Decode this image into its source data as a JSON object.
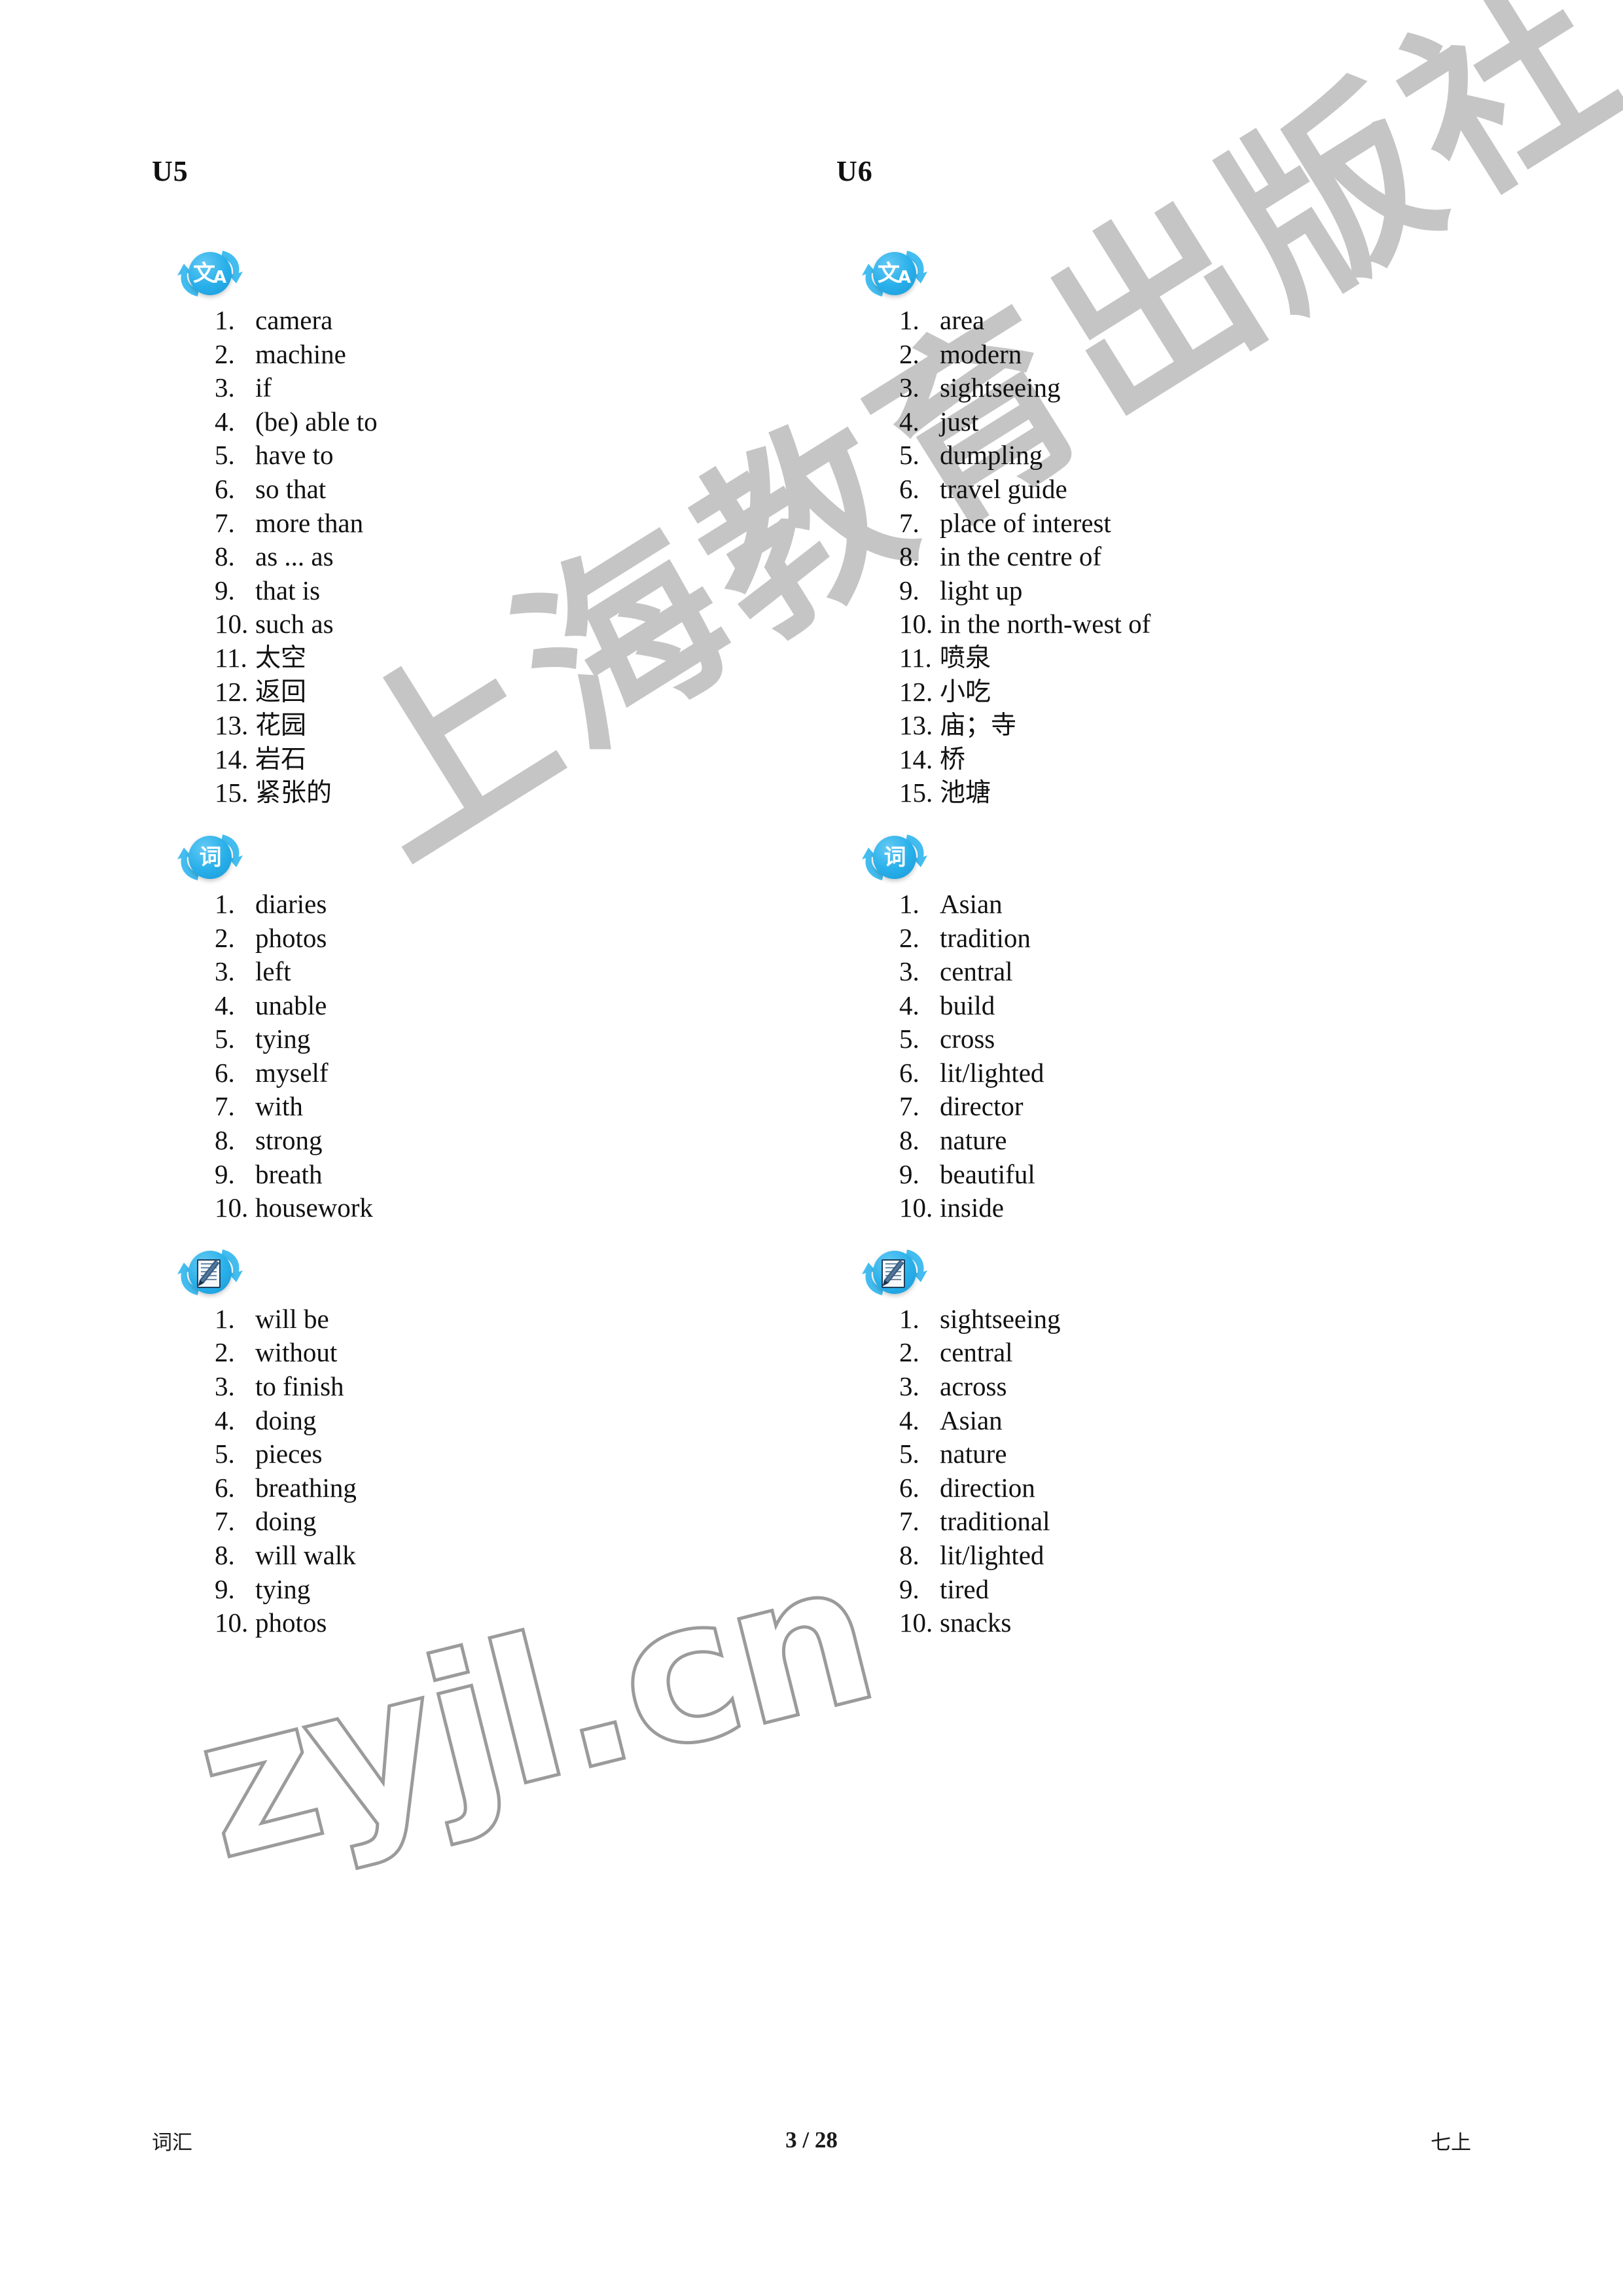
{
  "page": {
    "footer_left": "词汇",
    "footer_center": "3 / 28",
    "footer_right": "七上",
    "watermark_publisher": "上海教育出版社",
    "watermark_site": "zyjl.cn",
    "accent_color": "#29b0ea",
    "watermark_color": "#c2c2c2"
  },
  "columns": [
    {
      "unit": "U5",
      "sections": [
        {
          "icon": "translate-icon",
          "icon_glyph": "文A",
          "items": [
            {
              "n": "1.",
              "t": "camera",
              "cjk": false
            },
            {
              "n": "2.",
              "t": "machine",
              "cjk": false
            },
            {
              "n": "3.",
              "t": "if",
              "cjk": false
            },
            {
              "n": "4.",
              "t": "(be) able to",
              "cjk": false
            },
            {
              "n": "5.",
              "t": "have to",
              "cjk": false
            },
            {
              "n": "6.",
              "t": "so that",
              "cjk": false
            },
            {
              "n": "7.",
              "t": "more than",
              "cjk": false
            },
            {
              "n": "8.",
              "t": "as ... as",
              "cjk": false
            },
            {
              "n": "9.",
              "t": "that is",
              "cjk": false
            },
            {
              "n": "10.",
              "t": "such as",
              "cjk": false
            },
            {
              "n": "11.",
              "t": "太空",
              "cjk": true
            },
            {
              "n": "12.",
              "t": "返回",
              "cjk": true
            },
            {
              "n": "13.",
              "t": "花园",
              "cjk": true
            },
            {
              "n": "14.",
              "t": "岩石",
              "cjk": true
            },
            {
              "n": "15.",
              "t": "紧张的",
              "cjk": true
            }
          ]
        },
        {
          "icon": "word-form-icon",
          "icon_glyph": "词",
          "items": [
            {
              "n": "1.",
              "t": "diaries",
              "cjk": false
            },
            {
              "n": "2.",
              "t": "photos",
              "cjk": false
            },
            {
              "n": "3.",
              "t": "left",
              "cjk": false
            },
            {
              "n": "4.",
              "t": "unable",
              "cjk": false
            },
            {
              "n": "5.",
              "t": "tying",
              "cjk": false
            },
            {
              "n": "6.",
              "t": "myself",
              "cjk": false
            },
            {
              "n": "7.",
              "t": "with",
              "cjk": false
            },
            {
              "n": "8.",
              "t": "strong",
              "cjk": false
            },
            {
              "n": "9.",
              "t": "breath",
              "cjk": false
            },
            {
              "n": "10.",
              "t": "housework",
              "cjk": false
            }
          ]
        },
        {
          "icon": "notepad-pencil-icon",
          "icon_glyph": "",
          "items": [
            {
              "n": "1.",
              "t": "will be",
              "cjk": false
            },
            {
              "n": "2.",
              "t": "without",
              "cjk": false
            },
            {
              "n": "3.",
              "t": "to finish",
              "cjk": false
            },
            {
              "n": "4.",
              "t": "doing",
              "cjk": false
            },
            {
              "n": "5.",
              "t": "pieces",
              "cjk": false
            },
            {
              "n": "6.",
              "t": "breathing",
              "cjk": false
            },
            {
              "n": "7.",
              "t": "doing",
              "cjk": false
            },
            {
              "n": "8.",
              "t": "will walk",
              "cjk": false
            },
            {
              "n": "9.",
              "t": "tying",
              "cjk": false
            },
            {
              "n": "10.",
              "t": "photos",
              "cjk": false
            }
          ]
        }
      ]
    },
    {
      "unit": "U6",
      "sections": [
        {
          "icon": "translate-icon",
          "icon_glyph": "文A",
          "items": [
            {
              "n": "1.",
              "t": "area",
              "cjk": false
            },
            {
              "n": "2.",
              "t": "modern",
              "cjk": false
            },
            {
              "n": "3.",
              "t": "sightseeing",
              "cjk": false
            },
            {
              "n": "4.",
              "t": "just",
              "cjk": false
            },
            {
              "n": "5.",
              "t": "dumpling",
              "cjk": false
            },
            {
              "n": "6.",
              "t": "travel guide",
              "cjk": false
            },
            {
              "n": "7.",
              "t": "place of interest",
              "cjk": false
            },
            {
              "n": "8.",
              "t": "in the centre of",
              "cjk": false
            },
            {
              "n": "9.",
              "t": "light up",
              "cjk": false
            },
            {
              "n": "10.",
              "t": "in the north-west of",
              "cjk": false
            },
            {
              "n": "11.",
              "t": "喷泉",
              "cjk": true
            },
            {
              "n": "12.",
              "t": "小吃",
              "cjk": true
            },
            {
              "n": "13.",
              "t": "庙；寺",
              "cjk": true
            },
            {
              "n": "14.",
              "t": "桥",
              "cjk": true
            },
            {
              "n": "15.",
              "t": "池塘",
              "cjk": true
            }
          ]
        },
        {
          "icon": "word-form-icon",
          "icon_glyph": "词",
          "items": [
            {
              "n": "1.",
              "t": "Asian",
              "cjk": false
            },
            {
              "n": "2.",
              "t": "tradition",
              "cjk": false
            },
            {
              "n": "3.",
              "t": "central",
              "cjk": false
            },
            {
              "n": "4.",
              "t": "build",
              "cjk": false
            },
            {
              "n": "5.",
              "t": "cross",
              "cjk": false
            },
            {
              "n": "6.",
              "t": "lit/lighted",
              "cjk": false
            },
            {
              "n": "7.",
              "t": "director",
              "cjk": false
            },
            {
              "n": "8.",
              "t": "nature",
              "cjk": false
            },
            {
              "n": "9.",
              "t": "beautiful",
              "cjk": false
            },
            {
              "n": "10.",
              "t": "inside",
              "cjk": false
            }
          ]
        },
        {
          "icon": "notepad-pencil-icon",
          "icon_glyph": "",
          "items": [
            {
              "n": "1.",
              "t": "sightseeing",
              "cjk": false
            },
            {
              "n": "2.",
              "t": "central",
              "cjk": false
            },
            {
              "n": "3.",
              "t": "across",
              "cjk": false
            },
            {
              "n": "4.",
              "t": "Asian",
              "cjk": false
            },
            {
              "n": "5.",
              "t": "nature",
              "cjk": false
            },
            {
              "n": "6.",
              "t": "direction",
              "cjk": false
            },
            {
              "n": "7.",
              "t": "traditional",
              "cjk": false
            },
            {
              "n": "8.",
              "t": "lit/lighted",
              "cjk": false
            },
            {
              "n": "9.",
              "t": "tired",
              "cjk": false
            },
            {
              "n": "10.",
              "t": "snacks",
              "cjk": false
            }
          ]
        }
      ]
    }
  ]
}
